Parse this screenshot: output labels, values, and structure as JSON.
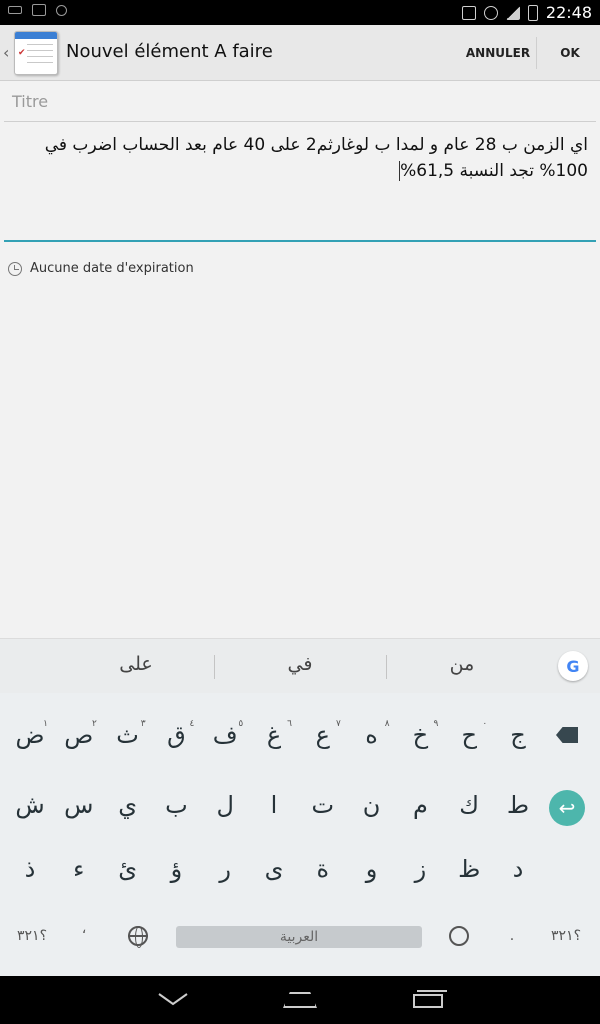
{
  "status_bar": {
    "time": "22:48"
  },
  "action_bar": {
    "title": "Nouvel élément A faire",
    "cancel_label": "ANNULER",
    "ok_label": "OK"
  },
  "form": {
    "title_placeholder": "Titre",
    "body_text": "اي الزمن ب 28 عام و لمدا ب لوغارثم2 على 40 عام بعد الحساب اضرب في 100% تجد النسبة 61,5%",
    "expiry_text": "Aucune date d'expiration"
  },
  "keyboard": {
    "suggestions": [
      "على",
      "في",
      "من"
    ],
    "row1": [
      {
        "k": "ض",
        "h": "١"
      },
      {
        "k": "ص",
        "h": "٢"
      },
      {
        "k": "ث",
        "h": "٣"
      },
      {
        "k": "ق",
        "h": "٤"
      },
      {
        "k": "ف",
        "h": "٥"
      },
      {
        "k": "غ",
        "h": "٦"
      },
      {
        "k": "ع",
        "h": "٧"
      },
      {
        "k": "ه",
        "h": "٨"
      },
      {
        "k": "خ",
        "h": "٩"
      },
      {
        "k": "ح",
        "h": "٠"
      },
      {
        "k": "ج",
        "h": ""
      }
    ],
    "row2": [
      "ش",
      "س",
      "ي",
      "ب",
      "ل",
      "ا",
      "ت",
      "ن",
      "م",
      "ك",
      "ط"
    ],
    "row3": [
      "ذ",
      "ء",
      "ئ",
      "ؤ",
      "ر",
      "ى",
      "ة",
      "و",
      "ز",
      "ظ",
      "د"
    ],
    "row4": {
      "left_symbols": "؟٣٢١",
      "comma": "،",
      "space": "العربية",
      "period": ".",
      "right_symbols": "؟٣٢١"
    }
  }
}
